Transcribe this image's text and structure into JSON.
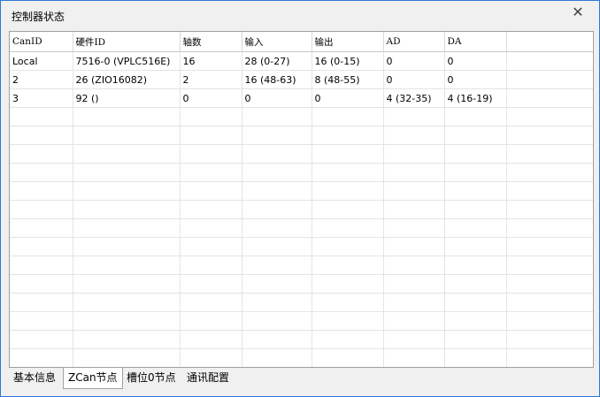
{
  "window": {
    "title": "控制器状态",
    "close_glyph": "✕"
  },
  "grid": {
    "columns": [
      "CanID",
      "硬件ID",
      "轴数",
      "输入",
      "输出",
      "AD",
      "DA",
      ""
    ],
    "rows": [
      [
        "Local",
        "7516-0 (VPLC516E)",
        "16",
        "28 (0-27)",
        "16 (0-15)",
        "0",
        "0",
        ""
      ],
      [
        "2",
        "26 (ZIO16082)",
        "2",
        "16 (48-63)",
        "8 (48-55)",
        "0",
        "0",
        ""
      ],
      [
        "3",
        "92 ()",
        "0",
        "0",
        "0",
        "4 (32-35)",
        "4 (16-19)",
        ""
      ]
    ],
    "empty_rows": 14
  },
  "tabs": [
    {
      "label": "基本信息",
      "active": false
    },
    {
      "label": "ZCan节点",
      "active": true
    },
    {
      "label": "槽位0节点",
      "active": false
    },
    {
      "label": "通讯配置",
      "active": false
    }
  ]
}
